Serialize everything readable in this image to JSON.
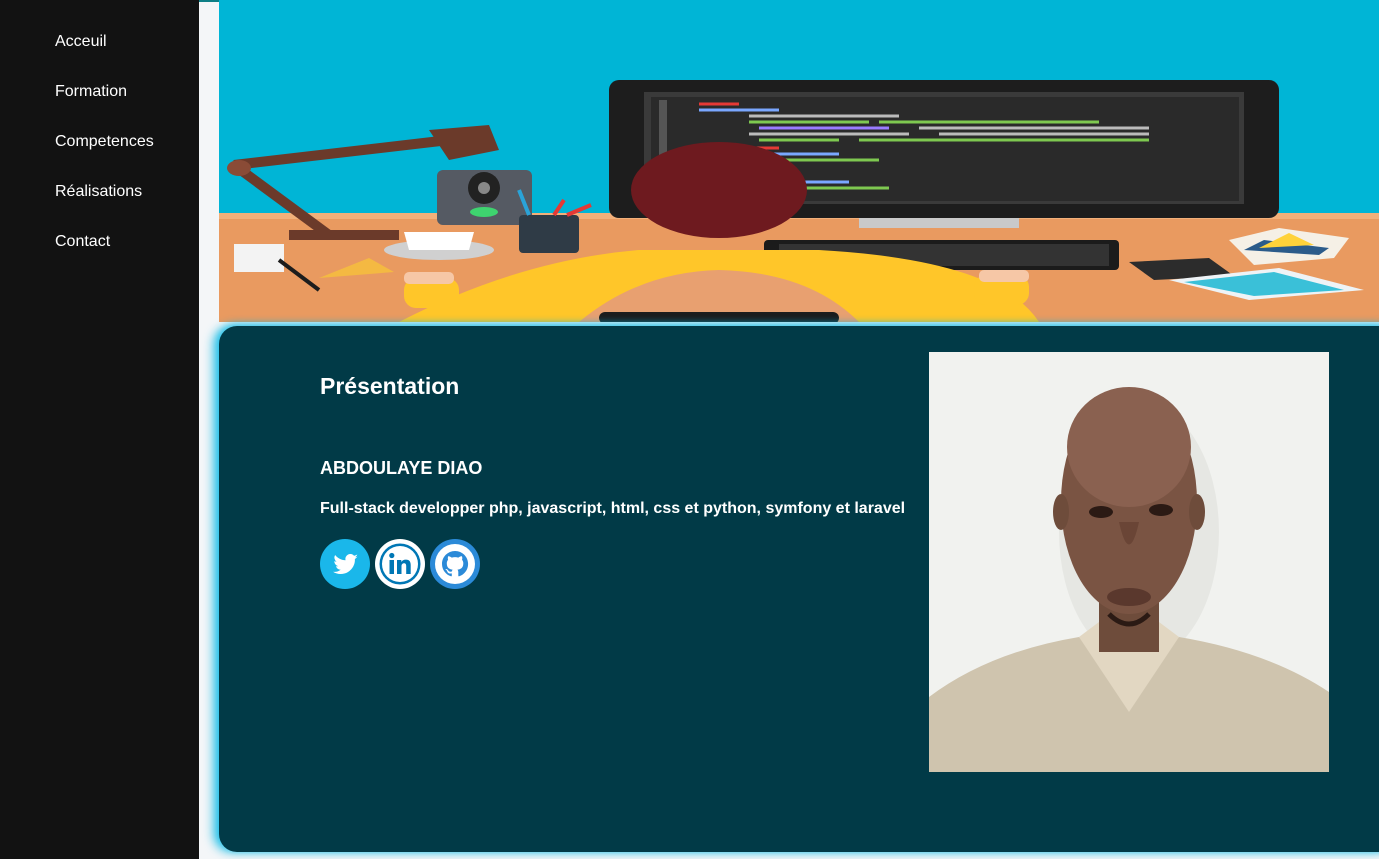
{
  "nav": {
    "items": [
      {
        "label": "Acceuil"
      },
      {
        "label": "Formation"
      },
      {
        "label": "Competences"
      },
      {
        "label": "Réalisations"
      },
      {
        "label": "Contact"
      }
    ]
  },
  "presentation": {
    "heading": "Présentation",
    "name": "ABDOULAYE DIAO",
    "role": "Full-stack developper php, javascript, html, css et python, symfony et laravel"
  },
  "socials": [
    {
      "icon": "twitter-icon",
      "color": "#1da1f2"
    },
    {
      "icon": "linkedin-icon",
      "color": "#0077b5"
    },
    {
      "icon": "github-icon",
      "color": "#2b8ad8"
    }
  ],
  "colors": {
    "sidebar": "#121212",
    "card": "#013a47",
    "glow": "#00b8e6",
    "banner_sky": "#00b5d6"
  }
}
